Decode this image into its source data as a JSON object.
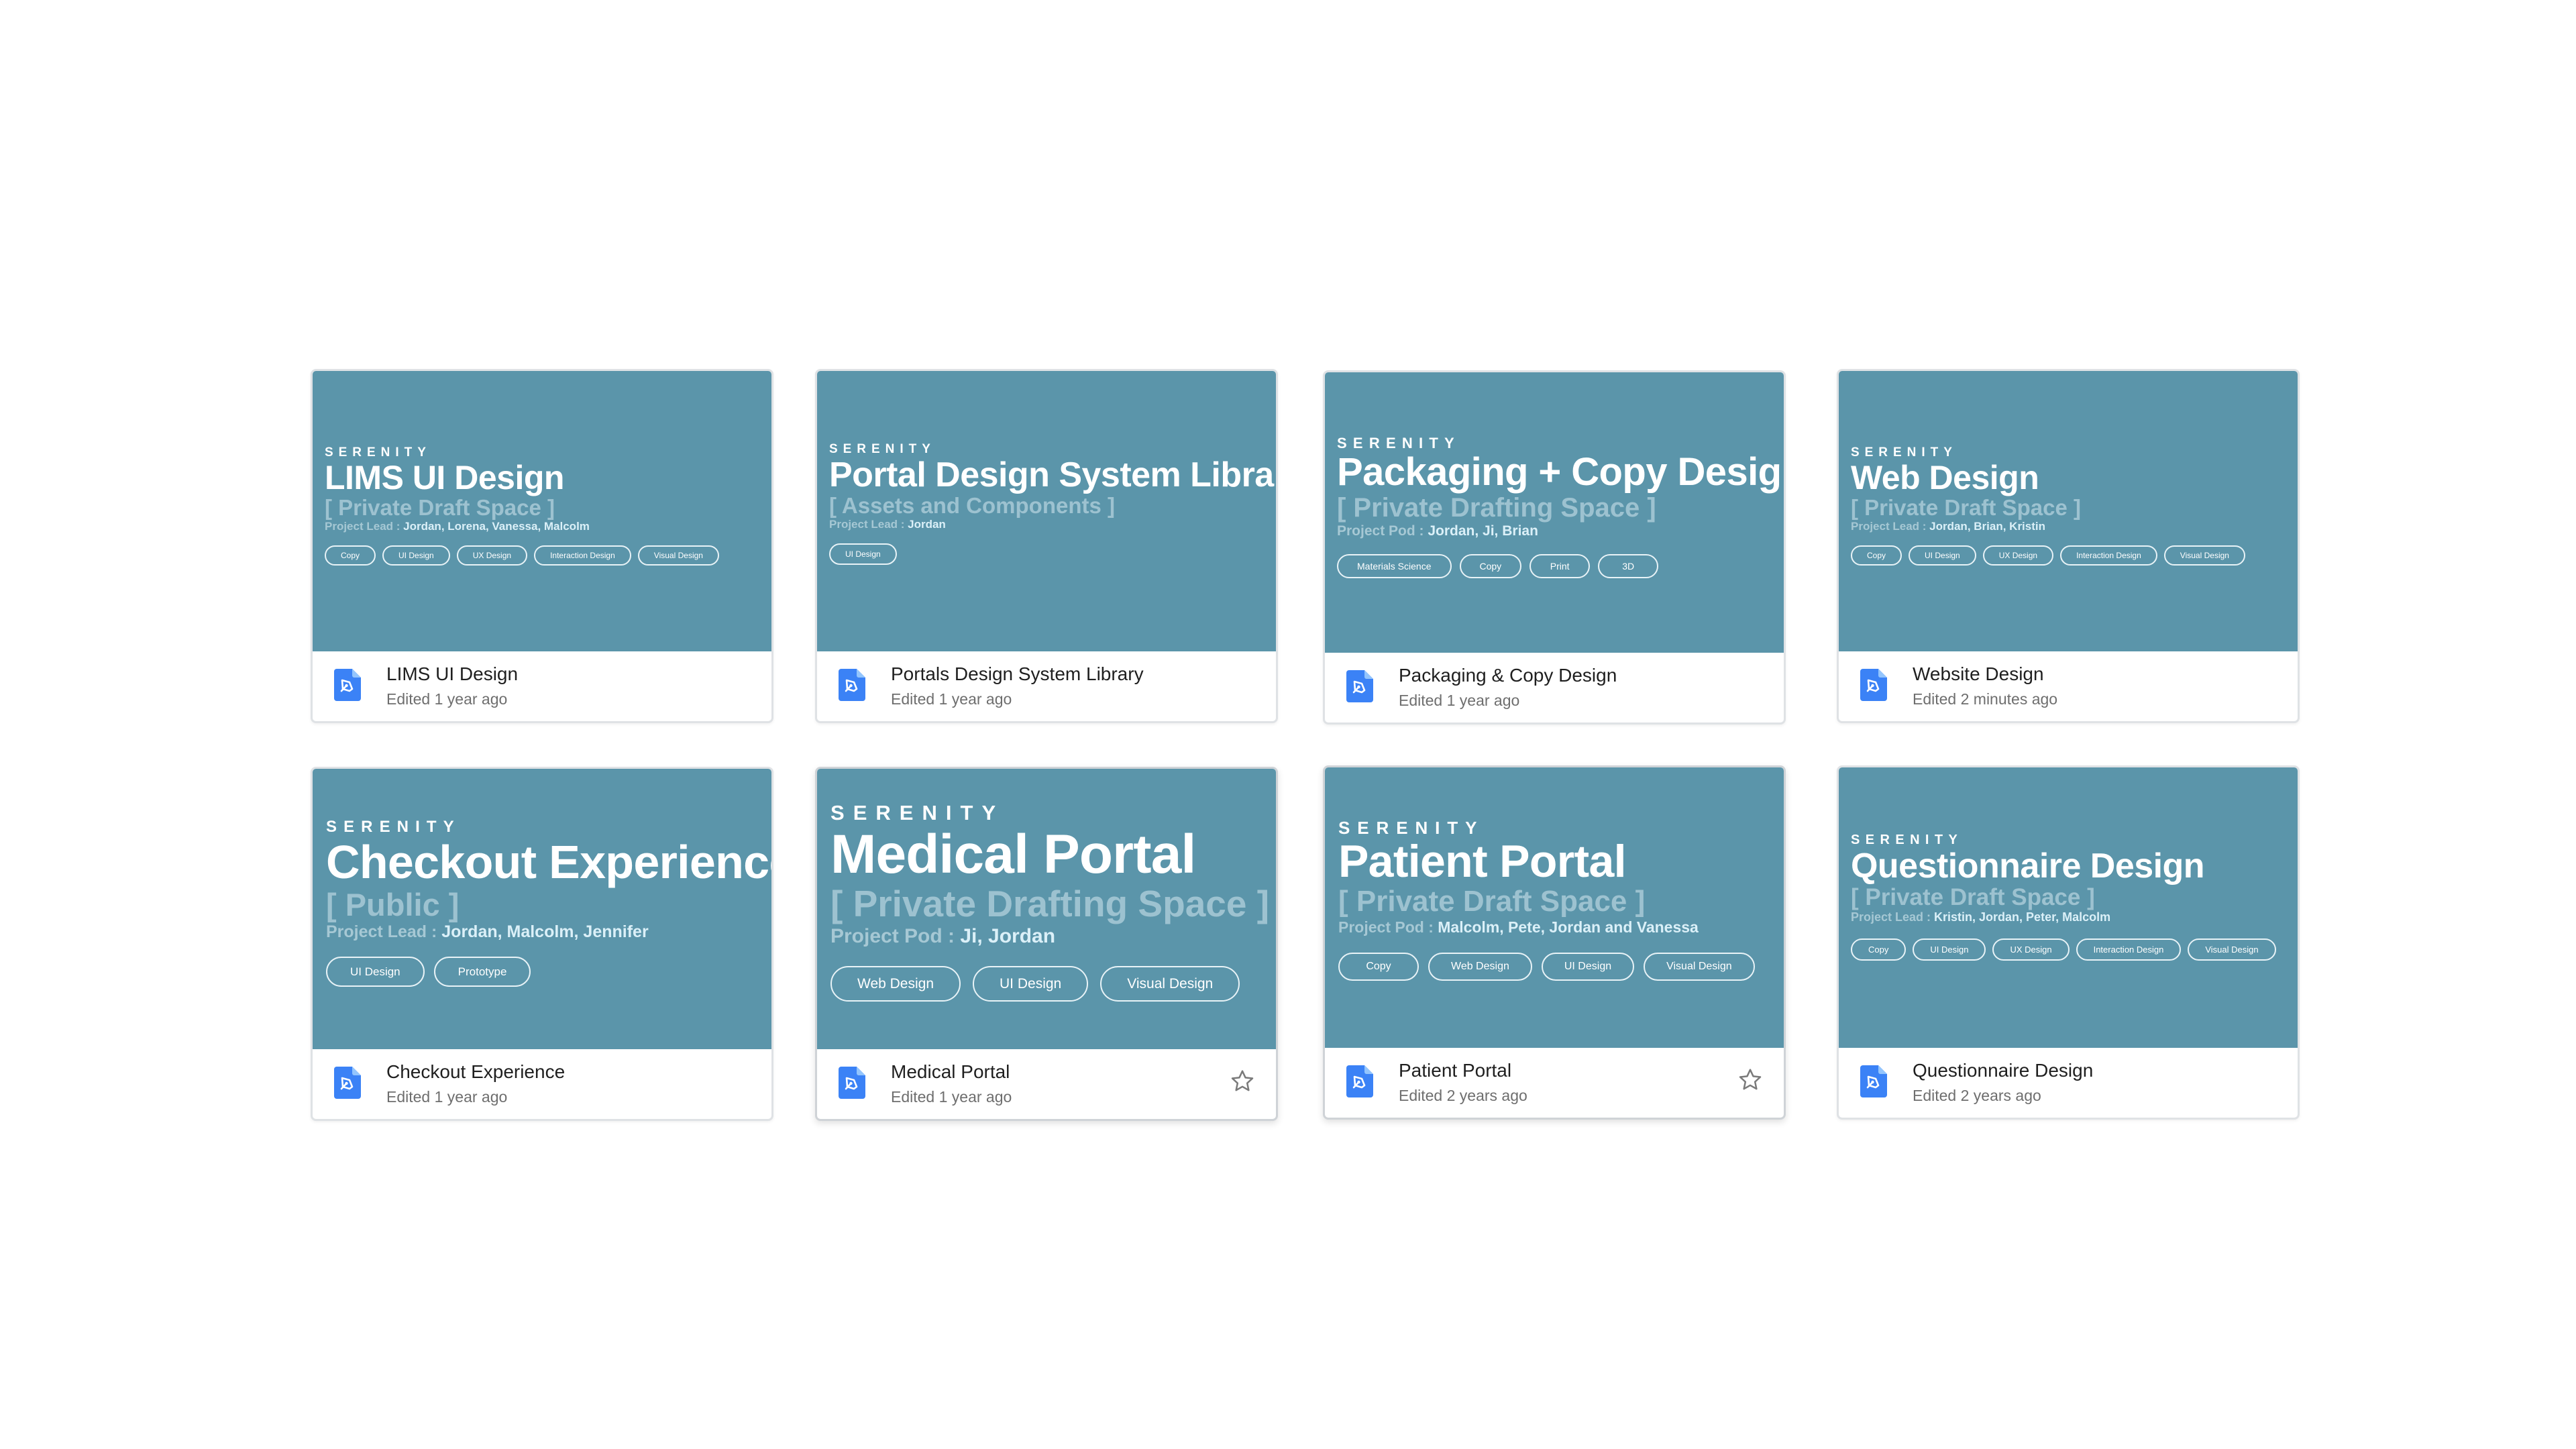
{
  "colors": {
    "thumbnail_bg": "#5b95aa",
    "title": "#ffffff",
    "subtitle": "#9dc2d0",
    "lead_names": "#dbf0f8",
    "doc_icon": "#3b82f6"
  },
  "cards": [
    {
      "brand": "SERENITY",
      "title": "LIMS UI Design",
      "subtitle": "[  Private Draft Space  ]",
      "lead_label": "Project Lead :",
      "lead_names": "Jordan, Lorena, Vanessa, Malcolm",
      "tags": [
        "Copy",
        "UI Design",
        "UX Design",
        "Interaction Design",
        "Visual Design"
      ],
      "file_name": "LIMS UI Design",
      "edited": "Edited 1 year ago",
      "icon": "pen-document-icon"
    },
    {
      "brand": "SERENITY",
      "title": "Portal Design System Library",
      "subtitle": "[  Assets and Components  ]",
      "lead_label": "Project Lead :",
      "lead_names": "Jordan",
      "tags": [
        "UI Design"
      ],
      "file_name": "Portals Design System Library",
      "edited": "Edited 1 year ago",
      "icon": "pen-document-icon"
    },
    {
      "brand": "SERENITY",
      "title": "Packaging + Copy Design",
      "subtitle": "[  Private Drafting Space  ]",
      "lead_label": "Project Pod :",
      "lead_names": "Jordan, Ji, Brian",
      "tags": [
        "Materials Science",
        "Copy",
        "Print",
        "3D"
      ],
      "file_name": "Packaging & Copy Design",
      "edited": "Edited 1 year ago",
      "icon": "pen-document-icon"
    },
    {
      "brand": "SERENITY",
      "title": "Web Design",
      "subtitle": "[  Private Draft Space  ]",
      "lead_label": "Project Lead :",
      "lead_names": "Jordan, Brian, Kristin",
      "tags": [
        "Copy",
        "UI Design",
        "UX Design",
        "Interaction Design",
        "Visual Design"
      ],
      "file_name": "Website Design",
      "edited": "Edited 2 minutes ago",
      "icon": "pen-document-icon"
    },
    {
      "brand": "SERENITY",
      "title": "Checkout Experience",
      "subtitle": "[  Public  ]",
      "lead_label": "Project Lead :",
      "lead_names": "Jordan, Malcolm, Jennifer",
      "tags": [
        "UI Design",
        "Prototype"
      ],
      "file_name": "Checkout Experience",
      "edited": "Edited 1 year ago",
      "icon": "pen-document-icon"
    },
    {
      "brand": "SERENITY",
      "title": "Medical Portal",
      "subtitle": "[  Private Drafting Space  ]",
      "lead_label": "Project Pod :",
      "lead_names": "Ji, Jordan",
      "tags": [
        "Web Design",
        "UI Design",
        "Visual Design"
      ],
      "file_name": "Medical Portal",
      "edited": "Edited 1 year ago",
      "icon": "pen-document-icon",
      "star": "star-outline-icon"
    },
    {
      "brand": "SERENITY",
      "title": "Patient Portal",
      "subtitle": "[  Private Draft Space  ]",
      "lead_label": "Project Pod :",
      "lead_names": "Malcolm, Pete, Jordan and Vanessa",
      "tags": [
        "Copy",
        "Web Design",
        "UI Design",
        "Visual Design"
      ],
      "file_name": "Patient Portal",
      "edited": "Edited 2 years ago",
      "icon": "pen-document-icon",
      "star": "star-outline-icon"
    },
    {
      "brand": "SERENITY",
      "title": "Questionnaire Design",
      "subtitle": "[  Private Draft Space  ]",
      "lead_label": "Project Lead :",
      "lead_names": "Kristin, Jordan, Peter, Malcolm",
      "tags": [
        "Copy",
        "UI Design",
        "UX Design",
        "Interaction Design",
        "Visual Design"
      ],
      "file_name": "Questionnaire Design",
      "edited": "Edited 2 years ago",
      "icon": "pen-document-icon"
    }
  ]
}
